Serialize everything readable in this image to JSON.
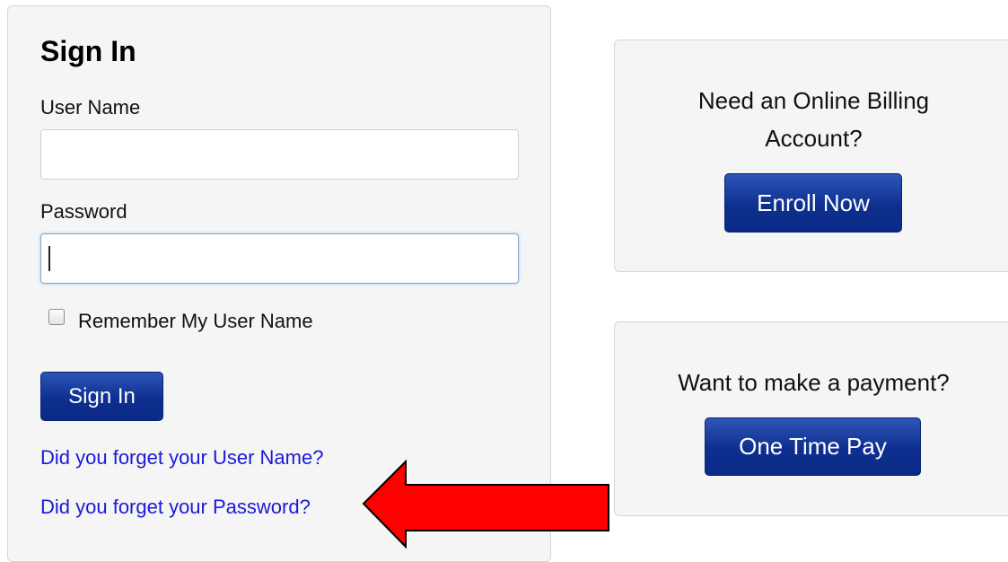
{
  "signin": {
    "title": "Sign In",
    "username_label": "User Name",
    "username_value": "",
    "password_label": "Password",
    "password_value": "",
    "remember_label": "Remember My User Name",
    "remember_checked": false,
    "submit_label": "Sign In",
    "forgot_username": "Did you forget your User Name?",
    "forgot_password": "Did you forget your Password?"
  },
  "enroll": {
    "heading_line1": "Need an Online Billing",
    "heading_line2": "Account?",
    "button_label": "Enroll Now"
  },
  "payment": {
    "heading": "Want to make a payment?",
    "button_label": "One Time Pay"
  },
  "colors": {
    "button_blue": "#0e2f8f",
    "link_blue": "#1a1ad6",
    "arrow_red": "#ff0000",
    "panel_bg": "#f5f5f5"
  },
  "annotation": {
    "arrow_icon": "red-arrow-left-icon"
  }
}
